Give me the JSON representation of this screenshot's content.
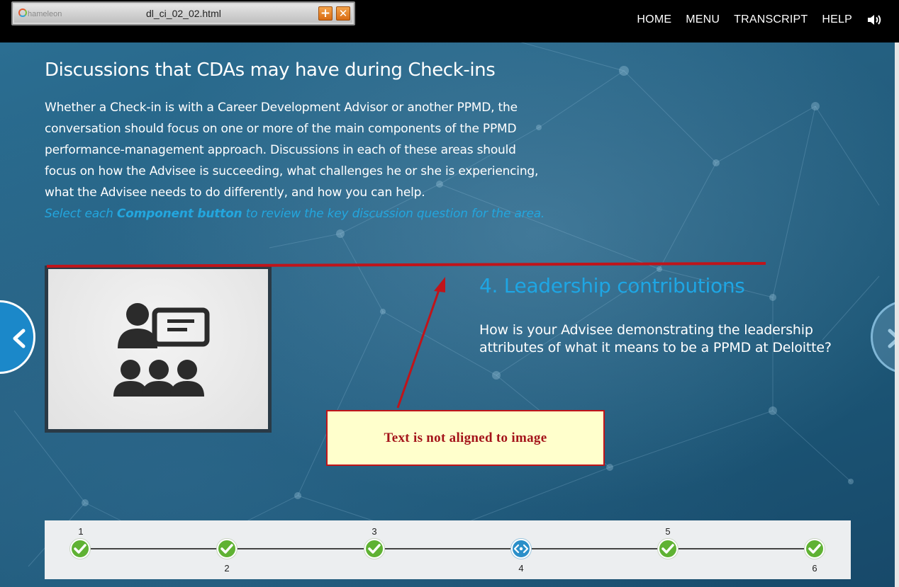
{
  "window": {
    "file_title": "dl_ci_02_02.html",
    "logo_text": "hameleon"
  },
  "nav": {
    "items": [
      "HOME",
      "MENU",
      "TRANSCRIPT",
      "HELP"
    ],
    "audio_icon": "speaker-icon"
  },
  "content": {
    "title": "Discussions that CDAs may have during Check-ins",
    "intro": "Whether a Check-in is with a Career Development Advisor or another PPMD, the conversation should focus on one or more of the main components of the PPMD performance-management approach. Discussions in each of these areas should focus on how the Advisee is succeeding, what challenges he or she is experiencing, what the Advisee needs to do differently, and how you can help.",
    "instruction_pre": "Select each ",
    "instruction_bold": "Component button",
    "instruction_post": " to review the key discussion question for the area."
  },
  "component": {
    "heading": "4. Leadership contributions",
    "question": "How is your Advisee demonstrating the leadership attributes of what it means to be a PPMD at Deloitte?",
    "image_icon": "presenter-audience-icon"
  },
  "annotation": {
    "text": "Text is not aligned to image",
    "color": "#c0141a"
  },
  "progress": {
    "steps": [
      {
        "label": "1",
        "status": "complete"
      },
      {
        "label": "2",
        "status": "complete"
      },
      {
        "label": "3",
        "status": "complete"
      },
      {
        "label": "4",
        "status": "current"
      },
      {
        "label": "5",
        "status": "complete"
      },
      {
        "label": "6",
        "status": "complete"
      }
    ]
  },
  "colors": {
    "accent_blue": "#1ea6e4",
    "complete_green": "#5fb233",
    "current_blue": "#2a8fc9"
  }
}
